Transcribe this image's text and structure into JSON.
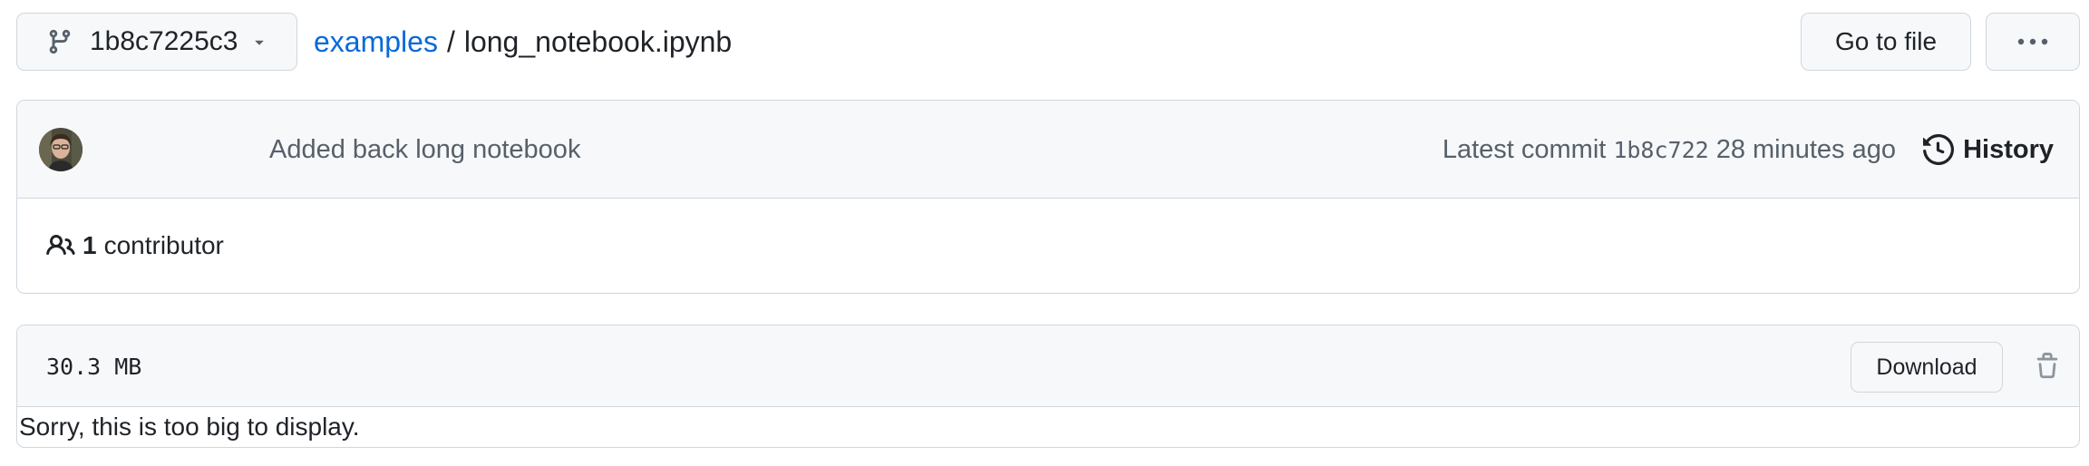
{
  "topbar": {
    "branch_name": "1b8c7225c3",
    "breadcrumb_repo": "examples",
    "breadcrumb_separator": "/",
    "breadcrumb_file": "long_notebook.ipynb",
    "goto_file_label": "Go to file",
    "more_icon": "kebab-horizontal-icon"
  },
  "commit": {
    "message": "Added back long notebook",
    "latest_commit_label": "Latest commit",
    "sha": "1b8c722",
    "time_ago": "28 minutes ago",
    "history_label": "History"
  },
  "contributors": {
    "count": "1",
    "label": "contributor"
  },
  "file": {
    "size": "30.3 MB",
    "download_label": "Download",
    "body_message": "Sorry, this is too big to display."
  },
  "colors": {
    "link": "#0969da",
    "border": "#d0d7de",
    "header_bg": "#f6f8fa",
    "muted_text": "#57606a"
  }
}
